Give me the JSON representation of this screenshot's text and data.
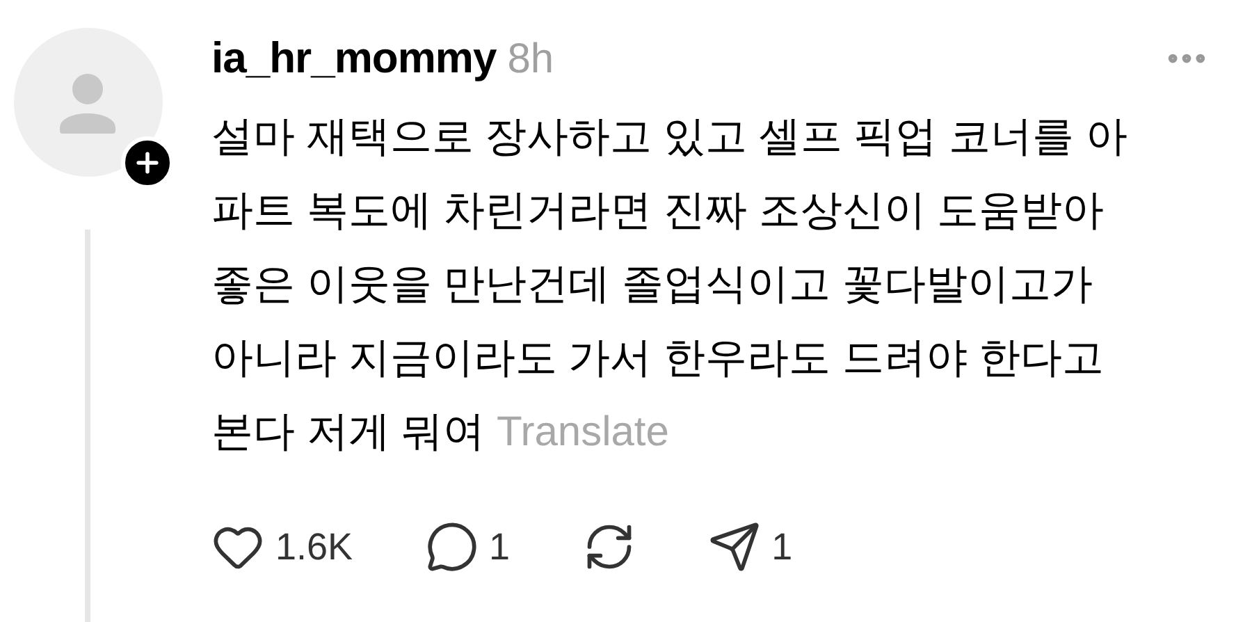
{
  "post": {
    "username": "ia_hr_mommy",
    "time": "8h",
    "body_lines": [
      "설마 재택으로 장사하고 있고 셀프 픽업 코너를 아",
      "파트 복도에 차린거라면 진짜 조상신이 도움받아",
      "좋은 이웃을 만난건데 졸업식이고 꽃다발이고가",
      "아니라 지금이라도 가서 한우라도 드려야 한다고",
      "본다 저게 뭐여"
    ],
    "translate": "Translate",
    "actions": [
      {
        "kind": "like",
        "count": "1.6K"
      },
      {
        "kind": "reply",
        "count": "1"
      },
      {
        "kind": "repost"
      },
      {
        "kind": "share",
        "count": "1"
      }
    ]
  }
}
